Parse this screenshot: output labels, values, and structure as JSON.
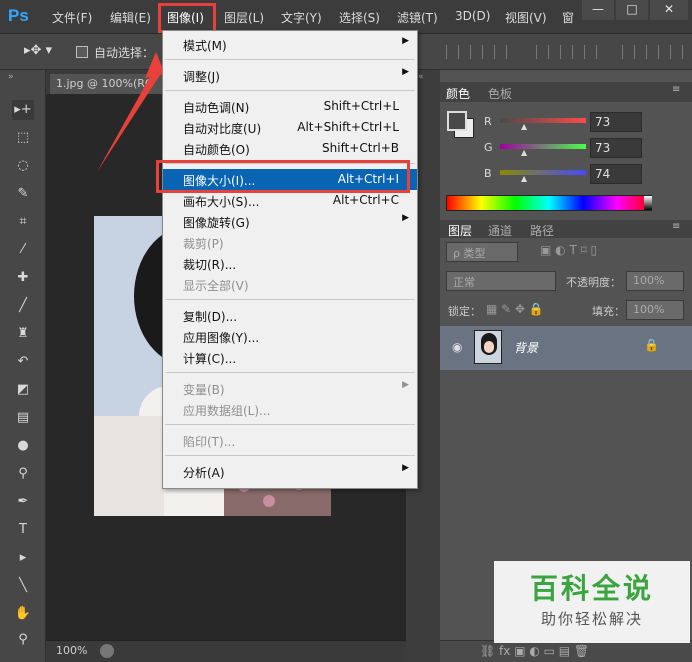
{
  "app": {
    "logo": "Ps",
    "menus": [
      "文件(F)",
      "编辑(E)",
      "图像(I)",
      "图层(L)",
      "文字(Y)",
      "选择(S)",
      "滤镜(T)",
      "3D(D)",
      "视图(V)",
      "窗"
    ],
    "window_buttons": [
      "—",
      "□",
      "✕"
    ]
  },
  "options_bar": {
    "auto_select_label": "自动选择："
  },
  "document": {
    "tab_title": "1.jpg @ 100%(RG",
    "zoom": "100%"
  },
  "color_panel": {
    "tabs": [
      "颜色",
      "色板"
    ],
    "channels": [
      {
        "label": "R",
        "value": "73"
      },
      {
        "label": "G",
        "value": "73"
      },
      {
        "label": "B",
        "value": "74"
      }
    ]
  },
  "layers_panel": {
    "tabs": [
      "图层",
      "通道",
      "路径"
    ],
    "filter_kind": "ρ 类型",
    "blend_mode": "正常",
    "opacity_label": "不透明度：",
    "opacity_value": "100%",
    "lock_label": "锁定：",
    "fill_label": "填充：",
    "fill_value": "100%",
    "layers": [
      {
        "name": "背景"
      }
    ]
  },
  "image_menu": {
    "items": [
      {
        "label": "模式(M)",
        "shortcut": "",
        "submenu": true,
        "disabled": false
      },
      {
        "sep": true
      },
      {
        "label": "调整(J)",
        "shortcut": "",
        "submenu": true,
        "disabled": false
      },
      {
        "sep": true
      },
      {
        "label": "自动色调(N)",
        "shortcut": "Shift+Ctrl+L",
        "submenu": false,
        "disabled": false
      },
      {
        "label": "自动对比度(U)",
        "shortcut": "Alt+Shift+Ctrl+L",
        "submenu": false,
        "disabled": false
      },
      {
        "label": "自动颜色(O)",
        "shortcut": "Shift+Ctrl+B",
        "submenu": false,
        "disabled": false
      },
      {
        "sep": true
      },
      {
        "label": "图像大小(I)...",
        "shortcut": "Alt+Ctrl+I",
        "submenu": false,
        "disabled": false,
        "highlighted": true
      },
      {
        "label": "画布大小(S)...",
        "shortcut": "Alt+Ctrl+C",
        "submenu": false,
        "disabled": false
      },
      {
        "label": "图像旋转(G)",
        "shortcut": "",
        "submenu": true,
        "disabled": false
      },
      {
        "label": "裁剪(P)",
        "shortcut": "",
        "submenu": false,
        "disabled": true
      },
      {
        "label": "裁切(R)...",
        "shortcut": "",
        "submenu": false,
        "disabled": false
      },
      {
        "label": "显示全部(V)",
        "shortcut": "",
        "submenu": false,
        "disabled": true
      },
      {
        "sep": true
      },
      {
        "label": "复制(D)...",
        "shortcut": "",
        "submenu": false,
        "disabled": false
      },
      {
        "label": "应用图像(Y)...",
        "shortcut": "",
        "submenu": false,
        "disabled": false
      },
      {
        "label": "计算(C)...",
        "shortcut": "",
        "submenu": false,
        "disabled": false
      },
      {
        "sep": true
      },
      {
        "label": "变量(B)",
        "shortcut": "",
        "submenu": true,
        "disabled": true
      },
      {
        "label": "应用数据组(L)...",
        "shortcut": "",
        "submenu": false,
        "disabled": true
      },
      {
        "sep": true
      },
      {
        "label": "陷印(T)...",
        "shortcut": "",
        "submenu": false,
        "disabled": true
      },
      {
        "sep": true
      },
      {
        "label": "分析(A)",
        "shortcut": "",
        "submenu": true,
        "disabled": false
      }
    ]
  },
  "watermark": {
    "title": "百科全说",
    "subtitle": "助你轻松解决"
  },
  "colors": {
    "menu_highlight": "#0a64b4",
    "annotation_red": "#e8403a",
    "ps_blue": "#31a8ff",
    "watermark_green": "#3aa43e"
  }
}
